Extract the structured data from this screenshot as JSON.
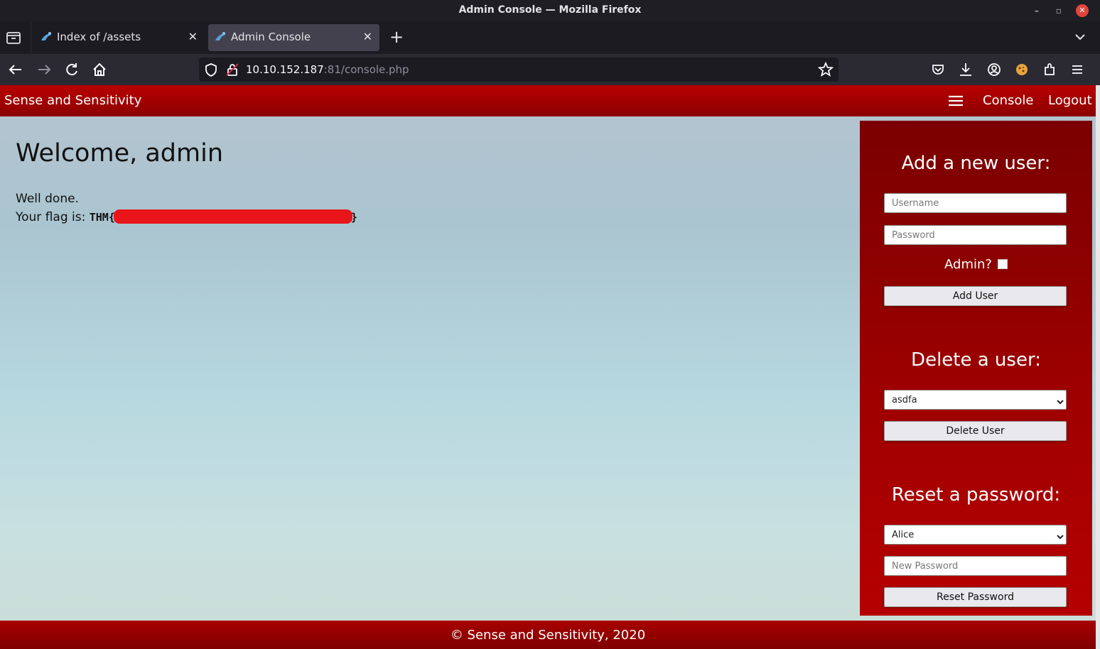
{
  "window": {
    "title": "Admin Console — Mozilla Firefox"
  },
  "tabs": [
    {
      "label": "Index of /assets",
      "active": false
    },
    {
      "label": "Admin Console",
      "active": true
    }
  ],
  "urlbar": {
    "host": "10.10.152.187",
    "rest": ":81/console.php"
  },
  "site": {
    "brand": "Sense and Sensitivity",
    "nav": {
      "console": "Console",
      "logout": "Logout"
    }
  },
  "main": {
    "heading": "Welcome, admin",
    "line1": "Well done.",
    "flag_prefix": "Your flag is: ",
    "flag_open": "THM{",
    "flag_close": "}"
  },
  "panel": {
    "add": {
      "title": "Add a new user:",
      "username_placeholder": "Username",
      "password_placeholder": "Password",
      "admin_label": "Admin?",
      "button": "Add User"
    },
    "delete": {
      "title": "Delete a user:",
      "selected": "asdfa",
      "button": "Delete User"
    },
    "reset": {
      "title": "Reset a password:",
      "selected": "Alice",
      "new_password_placeholder": "New Password",
      "button": "Reset Password"
    }
  },
  "footer": {
    "text": "© Sense and Sensitivity, 2020"
  },
  "colors": {
    "brand_red": "#a80000",
    "panel_red": "#8b0000",
    "redaction": "#e8151b"
  }
}
